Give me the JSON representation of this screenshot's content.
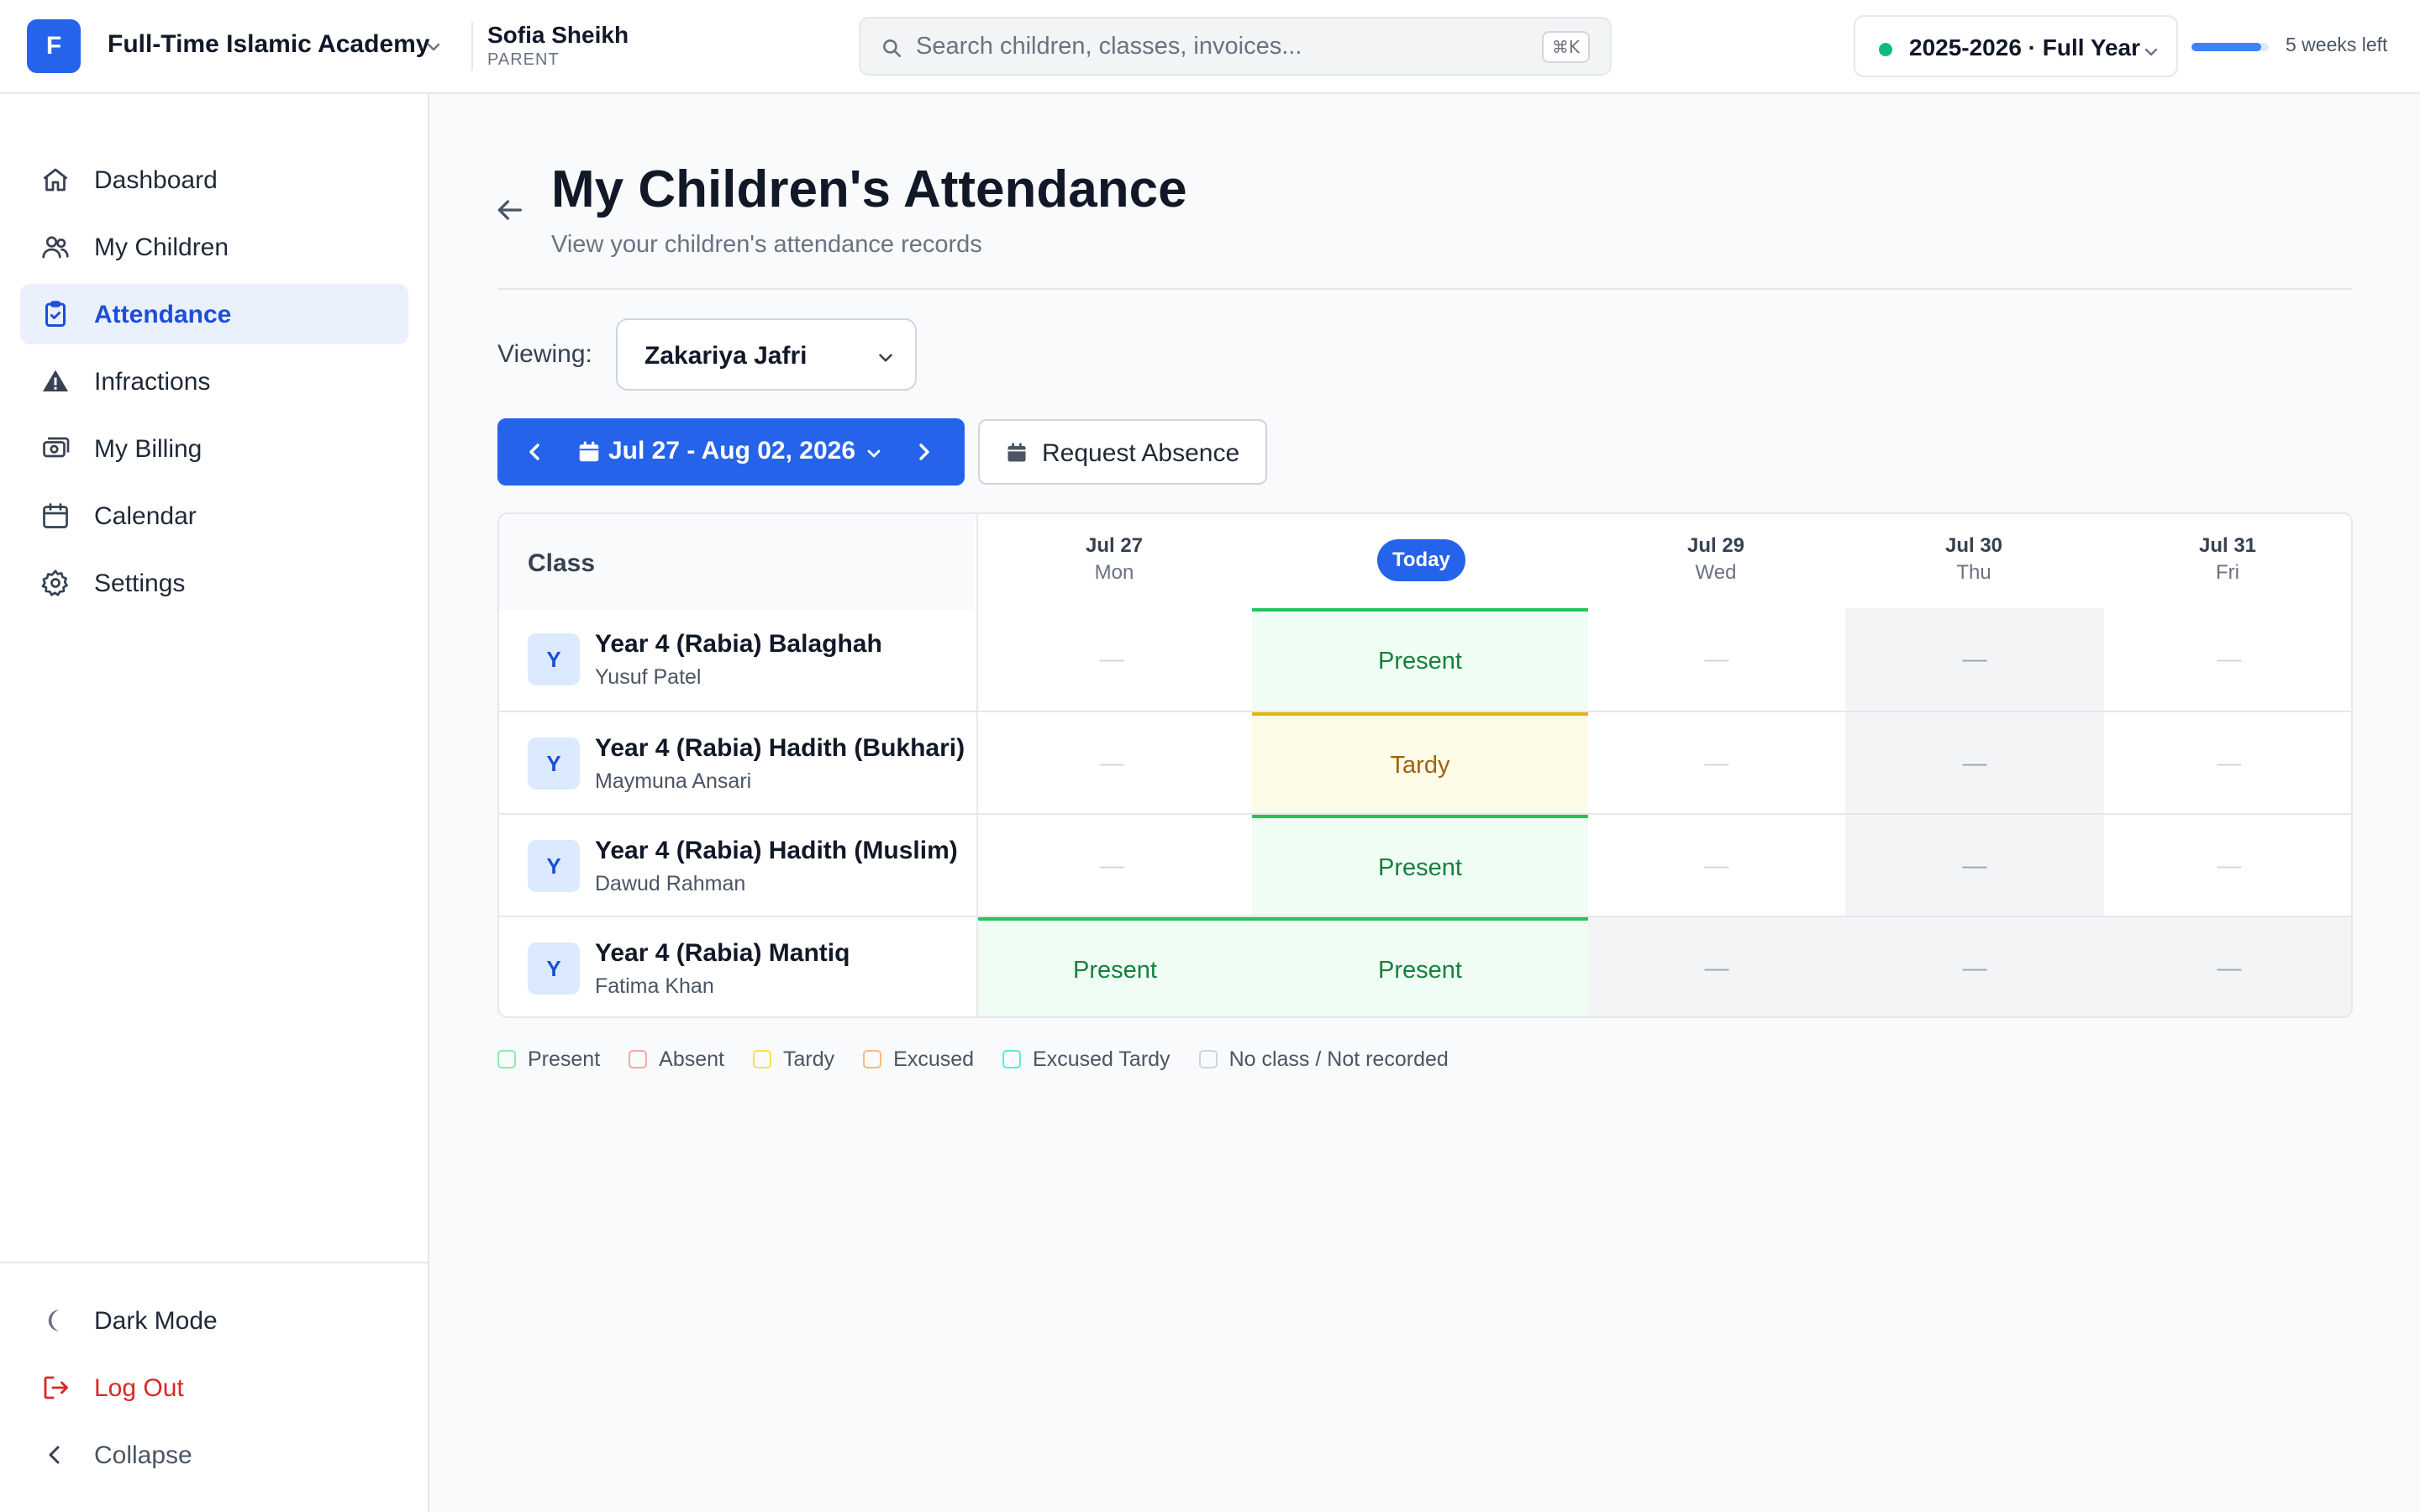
{
  "header": {
    "logo_letter": "F",
    "org_name": "Full-Time Islamic Academy",
    "user_name": "Sofia Sheikh",
    "user_role": "PARENT",
    "search_placeholder": "Search children, classes, invoices...",
    "search_shortcut": "⌘K",
    "year_label": "2025-2026 · Full Year",
    "year_progress_percent": 90,
    "weeks_left": "5 weeks left"
  },
  "sidebar": {
    "items": [
      {
        "label": "Dashboard",
        "icon": "home-icon",
        "active": false
      },
      {
        "label": "My Children",
        "icon": "users-icon",
        "active": false
      },
      {
        "label": "Attendance",
        "icon": "clipboard-check-icon",
        "active": true
      },
      {
        "label": "Infractions",
        "icon": "warning-icon",
        "active": false
      },
      {
        "label": "My Billing",
        "icon": "cash-icon",
        "active": false
      },
      {
        "label": "Calendar",
        "icon": "calendar-icon",
        "active": false
      },
      {
        "label": "Settings",
        "icon": "gear-icon",
        "active": false
      }
    ],
    "footer": {
      "dark_mode": "Dark Mode",
      "logout": "Log Out",
      "collapse": "Collapse"
    }
  },
  "main": {
    "title": "My Children's Attendance",
    "subtitle": "View your children's attendance records",
    "viewing_label": "Viewing:",
    "selected_child": "Zakariya Jafri",
    "week_range": "Jul 27 - Aug 02, 2026",
    "request_absence": "Request Absence"
  },
  "table": {
    "class_header": "Class",
    "days": [
      {
        "date": "Jul 27",
        "dow": "Mon"
      },
      {
        "date": "Today",
        "dow": ""
      },
      {
        "date": "Jul 29",
        "dow": "Wed"
      },
      {
        "date": "Jul 30",
        "dow": "Thu"
      },
      {
        "date": "Jul 31",
        "dow": "Fri"
      }
    ],
    "rows": [
      {
        "avatar": "Y",
        "name": "Year 4 (Rabia) Balaghah",
        "teacher": "Yusuf Patel",
        "cells": [
          "—",
          "Present",
          "—",
          "—",
          "—"
        ]
      },
      {
        "avatar": "Y",
        "name": "Year 4 (Rabia) Hadith (Bukhari)",
        "teacher": "Maymuna Ansari",
        "cells": [
          "—",
          "Tardy",
          "—",
          "—",
          "—"
        ]
      },
      {
        "avatar": "Y",
        "name": "Year 4 (Rabia) Hadith (Muslim)",
        "teacher": "Dawud Rahman",
        "cells": [
          "—",
          "Present",
          "—",
          "—",
          "—"
        ]
      },
      {
        "avatar": "Y",
        "name": "Year 4 (Rabia) Mantiq",
        "teacher": "Fatima Khan",
        "cells": [
          "Present",
          "Present",
          "—",
          "—",
          "—"
        ]
      }
    ]
  },
  "legend": [
    {
      "label": "Present",
      "color": "#86efac"
    },
    {
      "label": "Absent",
      "color": "#fca5a5"
    },
    {
      "label": "Tardy",
      "color": "#fde047"
    },
    {
      "label": "Excused",
      "color": "#fdba74"
    },
    {
      "label": "Excused Tardy",
      "color": "#5eead4"
    },
    {
      "label": "No class / Not recorded",
      "color": "#d1d5db"
    }
  ],
  "colors": {
    "primary": "#2563eb",
    "present_bg": "#f0fdf4",
    "present_text": "#15803d",
    "tardy_bg": "#fefce8",
    "tardy_text": "#a16207",
    "danger": "#dc2626"
  }
}
